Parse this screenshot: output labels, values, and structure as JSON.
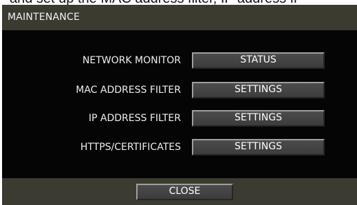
{
  "caption": {
    "text": "and set up the MAC address filter, IP address fi"
  },
  "dialog": {
    "title": "MAINTENANCE",
    "rows": [
      {
        "label": "NETWORK MONITOR",
        "button": "STATUS"
      },
      {
        "label": "MAC ADDRESS FILTER",
        "button": "SETTINGS"
      },
      {
        "label": "IP ADDRESS FILTER",
        "button": "SETTINGS"
      },
      {
        "label": "HTTPS/CERTIFICATES",
        "button": "SETTINGS"
      }
    ],
    "close_label": "CLOSE"
  },
  "colors": {
    "bar": "#3b3b32",
    "panel": "#050505",
    "button": "#444444"
  }
}
